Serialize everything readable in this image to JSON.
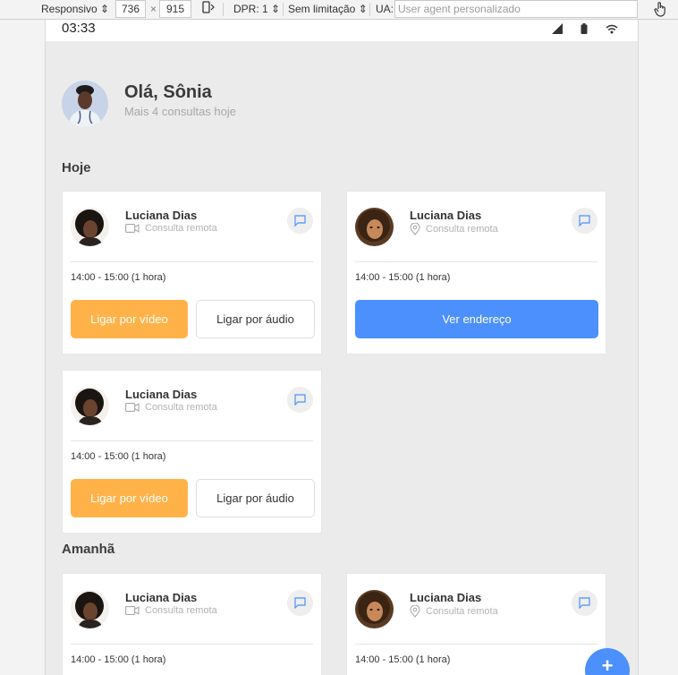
{
  "devtools": {
    "device": "Responsivo",
    "width": "736",
    "times": "×",
    "height": "915",
    "dpr": "DPR: 1",
    "throttle": "Sem limitação",
    "ua_label": "UA:",
    "ua_placeholder": "User agent personalizado"
  },
  "statusbar": {
    "time": "03:33"
  },
  "greeting": {
    "title": "Olá, Sônia",
    "subtitle": "Mais 4 consultas hoje"
  },
  "sections": {
    "today": "Hoje",
    "tomorrow": "Amanhã"
  },
  "cards": [
    {
      "name": "Luciana Dias",
      "type": "Consulta remota",
      "time": "14:00 - 15:00 (1 hora)",
      "video_button": "Ligar por vídeo",
      "audio_button": "Ligar por áudio"
    },
    {
      "name": "Luciana Dias",
      "type": "Consulta remota",
      "time": "14:00 - 15:00 (1 hora)",
      "address_button": "Ver endereço"
    },
    {
      "name": "Luciana Dias",
      "type": "Consulta remota",
      "time": "14:00 - 15:00 (1 hora)",
      "video_button": "Ligar por vídeo",
      "audio_button": "Ligar por áudio"
    },
    {
      "name": "Luciana Dias",
      "type": "Consulta remota",
      "time": "14:00 - 15:00 (1 hora)"
    },
    {
      "name": "Luciana Dias",
      "type": "Consulta remota",
      "time": "14:00 - 15:00 (1 hora)"
    }
  ],
  "fab": {
    "label": "+"
  },
  "colors": {
    "accent_blue": "#4b90fc",
    "accent_orange": "#ffb248",
    "background": "#ebebeb"
  }
}
